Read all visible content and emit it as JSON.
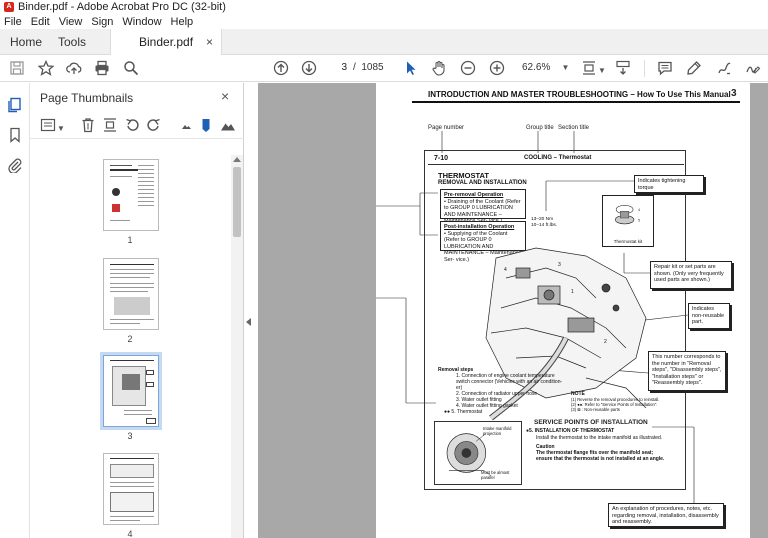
{
  "window": {
    "title": "Binder.pdf - Adobe Acrobat Pro DC (32-bit)",
    "app_icon_glyph": "A"
  },
  "menu": [
    "File",
    "Edit",
    "View",
    "Sign",
    "Window",
    "Help"
  ],
  "tabs": {
    "home": "Home",
    "tools": "Tools",
    "document": "Binder.pdf",
    "close_glyph": "×"
  },
  "toolbar": {
    "current_page": "3",
    "page_separator": "/",
    "total_pages": "1085",
    "zoom": "62.6%",
    "icons": [
      "save-icon",
      "bookmark-star-icon",
      "cloud-upload-icon",
      "print-icon",
      "zoom-search-icon",
      "arrow-up-circle-icon",
      "arrow-down-circle-icon",
      "select-arrow-icon",
      "hand-icon",
      "zoom-out-icon",
      "zoom-in-icon",
      "page-fit-icon",
      "scroll-mode-icon",
      "comment-icon",
      "highlight-pen-icon",
      "draw-icon",
      "sign-icon"
    ]
  },
  "rail": {
    "icons": [
      "page-thumbnails-icon",
      "bookmarks-icon",
      "attachments-icon"
    ]
  },
  "thumbnails": {
    "title": "Page Thumbnails",
    "close_glyph": "×",
    "tools": [
      "options-menu-icon",
      "delete-icon",
      "insert-page-icon",
      "rotate-left-icon",
      "rotate-right-icon",
      "thumb-smaller-icon",
      "marker-icon",
      "thumb-larger-icon"
    ],
    "pages": [
      {
        "label": "1",
        "selected": false
      },
      {
        "label": "2",
        "selected": false
      },
      {
        "label": "3",
        "selected": true
      },
      {
        "label": "4",
        "selected": false
      }
    ]
  },
  "document": {
    "header": "INTRODUCTION AND MASTER TROUBLESHOOTING – How To Use This Manual",
    "page_number": "3",
    "labels": {
      "page_number": "Page number",
      "group_title": "Group title",
      "section_title": "Section title",
      "section_num": "7-10",
      "section_name": "COOLING – Thermostat"
    },
    "content": {
      "title": "THERMOSTAT",
      "subtitle": "REMOVAL AND INSTALLATION",
      "pre_title": "Pre-removal Operation",
      "pre_text": "• Draining of the Coolant (Refer to GROUP 0 LUBRICATION AND MAINTENANCE – Maintenance Ser- vice.)",
      "post_title": "Post-installation Operation",
      "post_text": "• Supplying of the Coolant (Refer to GROUP 0 LUBRICATION AND MAINTENANCE – Maintenance Ser- vice.)",
      "torque_spec": "13–20 Nm\n10–14 ft.lbs.",
      "kit_label": "Thermostat kit",
      "removal_title": "Removal steps",
      "removal_steps": [
        "1. Connection of engine coolant temperature",
        "   switch connector (Vehicles with an air condition-",
        "   er)",
        "2. Connection of radiator upper hose",
        "3. Water outlet fitting",
        "4. Water outlet fitting gasket",
        "●● 5. Thermostat"
      ],
      "note_title": "NOTE",
      "notes": [
        "(1) Reverse the removal procedures to reinstall.",
        "(2) ●●: Refer to \"Service Points of Installation\".",
        "(3) ⊠ : Non-reusable parts"
      ],
      "service_title": "SERVICE POINTS OF INSTALLATION",
      "service_step": "●5. INSTALLATION OF THERMOSTAT",
      "service_text": "Install the thermostat to the intake manifold as illustrated.",
      "caution_title": "Caution",
      "caution_text_1": "The thermostat flange fits over the manifold seat;",
      "caution_text_2": "ensure that the thermostat is not installed at an angle.",
      "diagram_label_1": "Intake manifold",
      "diagram_label_2": "projection",
      "diagram_label_3": "Must be almost",
      "diagram_label_4": "parallel"
    },
    "callouts": {
      "torque": "Indicates tightening torque",
      "repair_kit": "Repair kit or set parts are shown. (Only very frequently used parts are shown.)",
      "non_reusable": "Indicates non-reusable part.",
      "number_corresponds": "This number corresponds to the number in \"Removal steps\", \"Disassembly steps\", \"Installation steps\" or \"Reassembly steps\".",
      "explanation": "An explanation of procedures, notes, etc. regarding removal, installation, disassembly and reassembly."
    }
  }
}
